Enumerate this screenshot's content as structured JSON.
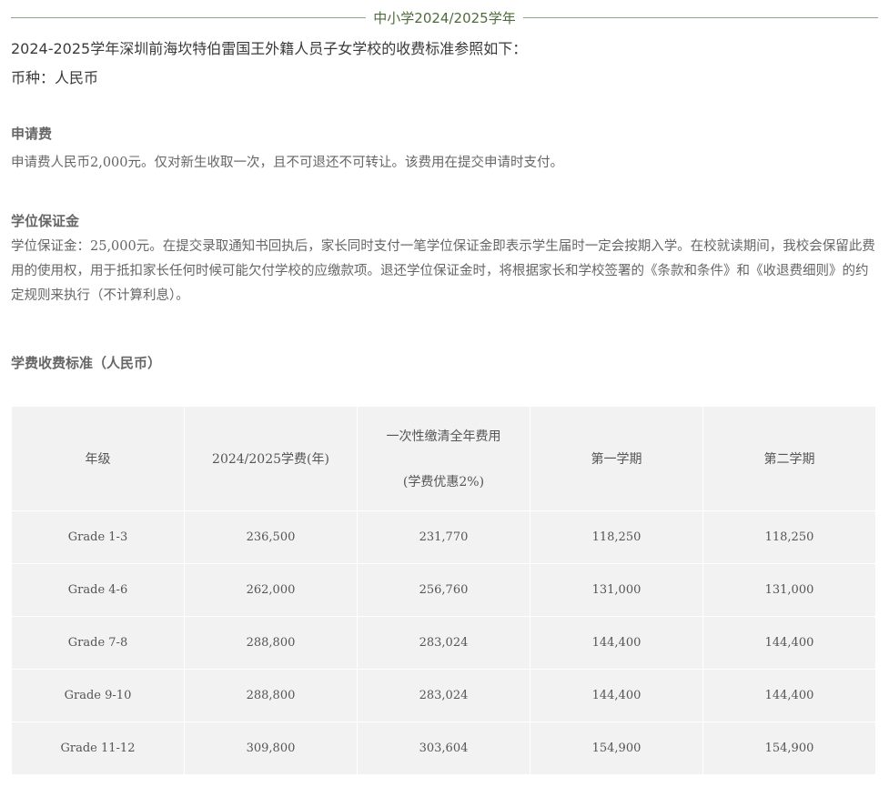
{
  "header": {
    "title": "中小学2024/2025学年"
  },
  "intro": {
    "line1": "2024-2025学年深圳前海坎特伯雷国王外籍人员子女学校的收费标准参照如下：",
    "line2": "币种：人民币"
  },
  "application_fee": {
    "title": "申请费",
    "text": "申请费人民币2,000元。仅对新生收取一次，且不可退还不可转让。该费用在提交申请时支付。"
  },
  "deposit": {
    "title": "学位保证金",
    "text": "学位保证金：25,000元。在提交录取通知书回执后，家长同时支付一笔学位保证金即表示学生届时一定会按期入学。在校就读期间，我校会保留此费用的使用权，用于抵扣家长任何时候可能欠付学校的应缴款项。退还学位保证金时，将根据家长和学校签署的《条款和条件》和《收退费细则》的约定规则来执行（不计算利息）。"
  },
  "tuition": {
    "title": "学费收费标准（人民币）",
    "headers": {
      "grade": "年级",
      "annual": "2024/2025学费(年)",
      "lump_line1": "一次性缴清全年费用",
      "lump_line2": "(学费优惠2%)",
      "term1": "第一学期",
      "term2": "第二学期"
    },
    "rows": [
      [
        "Grade 1-3",
        "236,500",
        "231,770",
        "118,250",
        "118,250"
      ],
      [
        "Grade 4-6",
        "262,000",
        "256,760",
        "131,000",
        "131,000"
      ],
      [
        "Grade 7-8",
        "288,800",
        "283,024",
        "144,400",
        "144,400"
      ],
      [
        "Grade 9-10",
        "288,800",
        "283,024",
        "144,400",
        "144,400"
      ],
      [
        "Grade 11-12",
        "309,800",
        "303,604",
        "154,900",
        "154,900"
      ]
    ]
  },
  "colors": {
    "header_green": "#4d6b3c",
    "rule_green": "#8fa77d",
    "table_bg": "#f2f2f2"
  }
}
